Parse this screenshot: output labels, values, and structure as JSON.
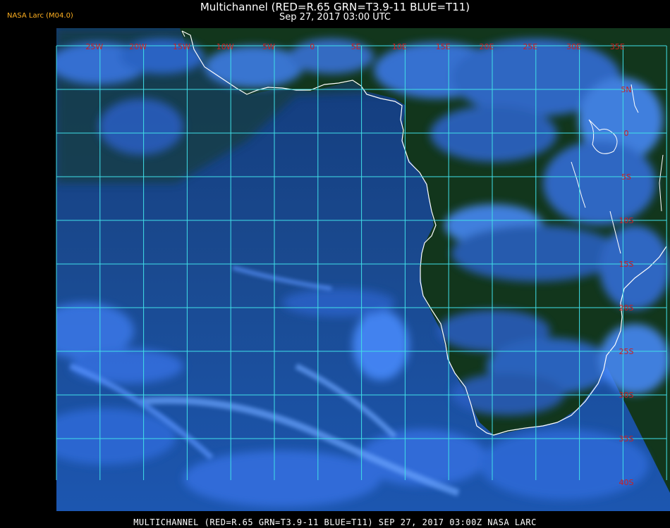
{
  "header": {
    "title": "Multichannel (RED=R.65 GRN=T3.9-11 BLUE=T11)",
    "datetime": "Sep 27, 2017 03:00 UTC",
    "source_badge": "NASA Larc (M04.0)"
  },
  "footer": {
    "caption": "MULTICHANNEL (RED=R.65 GRN=T3.9-11 BLUE=T11) SEP 27, 2017 03:00Z  NASA LARC"
  },
  "grid": {
    "longitude_labels": [
      "25W",
      "20W",
      "15W",
      "10W",
      "5W",
      "0",
      "5E",
      "10E",
      "15E",
      "20E",
      "25E",
      "30E",
      "35E"
    ],
    "latitude_labels": [
      "5N",
      "0",
      "5S",
      "10S",
      "15S",
      "20S",
      "25S",
      "30S",
      "35S",
      "40S"
    ]
  },
  "colors": {
    "background": "#000000",
    "ocean": "#1a4a8c",
    "land": "#0f3a18",
    "cloud": "#4a8cff",
    "grid_line": "#40e0e8",
    "grid_label": "#cc2020",
    "coastline": "#ffffff",
    "badge": "#ffb020"
  }
}
